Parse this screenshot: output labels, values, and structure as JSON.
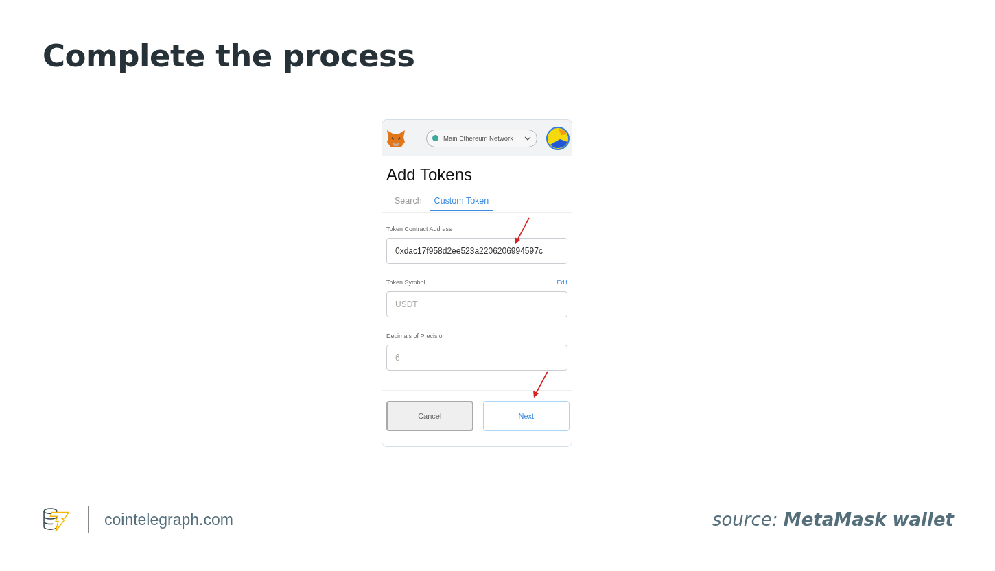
{
  "title": "Complete the process",
  "wallet": {
    "network": {
      "label": "Main Ethereum Network",
      "color": "#3fa99b"
    },
    "heading": "Add Tokens",
    "tabs": [
      {
        "label": "Search",
        "selected": false
      },
      {
        "label": "Custom Token",
        "selected": true
      }
    ],
    "fields": [
      {
        "label": "Token Contract Address",
        "value": "0xdac17f958d2ee523a2206206994597c",
        "disabled": false,
        "pointed": true
      },
      {
        "label": "Token Symbol",
        "action": "Edit",
        "value": "USDT",
        "disabled": true,
        "pointed": false
      },
      {
        "label": "Decimals of Precision",
        "value": "6",
        "disabled": true,
        "pointed": false
      }
    ],
    "buttons": [
      {
        "label": "Cancel",
        "kind": "secondary",
        "pointed": false
      },
      {
        "label": "Next",
        "kind": "primary",
        "pointed": true
      }
    ]
  },
  "footer": {
    "site": "cointelegraph.com",
    "source": "source: **MetaMask wallet**"
  }
}
